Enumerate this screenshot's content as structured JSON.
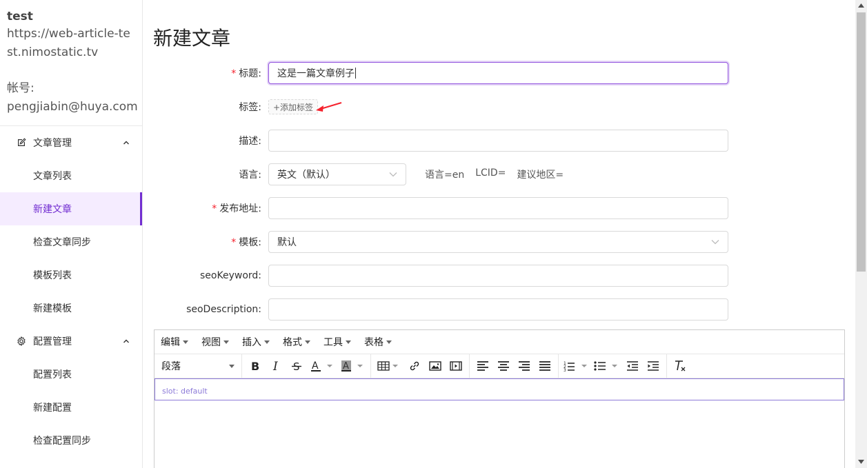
{
  "sidebar": {
    "site_name": "test",
    "site_url": "https://web-article-test.nimostatic.tv",
    "account_label": "帐号:",
    "account_value": "pengjiabin@huya.com",
    "groups": [
      {
        "title": "文章管理",
        "icon": "edit-icon",
        "items": [
          {
            "label": "文章列表"
          },
          {
            "label": "新建文章"
          },
          {
            "label": "检查文章同步"
          },
          {
            "label": "模板列表"
          },
          {
            "label": "新建模板"
          }
        ]
      },
      {
        "title": "配置管理",
        "icon": "gear-icon",
        "items": [
          {
            "label": "配置列表"
          },
          {
            "label": "新建配置"
          },
          {
            "label": "检查配置同步"
          }
        ]
      }
    ],
    "active_item": "新建文章"
  },
  "main": {
    "page_title": "新建文章",
    "form": {
      "title_label": "标题:",
      "title_value": "这是一篇文章例子",
      "tags_label": "标签:",
      "tags_add": "+添加标签",
      "desc_label": "描述:",
      "desc_value": "",
      "lang_label": "语言:",
      "lang_value": "英文（默认）",
      "lang_info": "语言=en",
      "lcid_info": "LCID=",
      "region_info": "建议地区=",
      "url_label": "发布地址:",
      "url_value": "",
      "template_label": "模板:",
      "template_value": "默认",
      "seo_keyword_label": "seoKeyword:",
      "seo_keyword_value": "",
      "seo_desc_label": "seoDescription:",
      "seo_desc_value": ""
    },
    "editor": {
      "menus": [
        "编辑",
        "视图",
        "插入",
        "格式",
        "工具",
        "表格"
      ],
      "paragraph_select": "段落",
      "slot_text": "slot: default"
    }
  },
  "colors": {
    "accent": "#722ed1",
    "active_bg": "#f5ecff",
    "required": "#f5222d",
    "focus_border": "#9254de"
  }
}
